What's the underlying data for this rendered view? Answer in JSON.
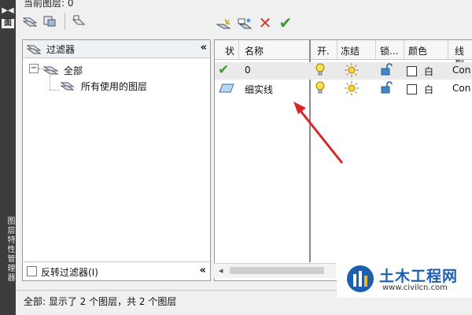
{
  "header": {
    "current_layer_label": "当前图层: 0"
  },
  "filter_panel": {
    "title": "过滤器",
    "tree": {
      "root": "全部",
      "child": "所有使用的图层"
    },
    "invert_filter_label": "反转过滤器(I)"
  },
  "layer_table": {
    "columns": [
      "状",
      "名称",
      "开.",
      "冻结",
      "锁...",
      "颜色",
      "线型"
    ],
    "rows": [
      {
        "name": "0",
        "color_label": "白",
        "linetype": "Con"
      },
      {
        "name": "细实线",
        "color_label": "白",
        "linetype": "Con"
      }
    ]
  },
  "status": {
    "text": "全部: 显示了 2 个图层，共 2 个图层"
  },
  "sidebar": {
    "top_glyph": "面",
    "vertical_text": "图层特性管理器"
  },
  "watermark": {
    "title": "土木工程网",
    "url": "www.civilcn.com"
  },
  "colors": {
    "accent_check": "#3a9a2a",
    "delete_x": "#d23a2a",
    "arrow": "#d8262a",
    "brand": "#1c5fb0"
  },
  "icons": [
    "new-property-filter-icon",
    "new-group-filter-icon",
    "layer-states-manager-icon",
    "new-layer-icon",
    "new-layer-vp-frozen-icon",
    "delete-layer-icon",
    "set-current-icon",
    "lightbulb-icon",
    "sun-icon",
    "unlocked-padlock-icon",
    "checkmark-icon",
    "parallelogram-icon"
  ]
}
